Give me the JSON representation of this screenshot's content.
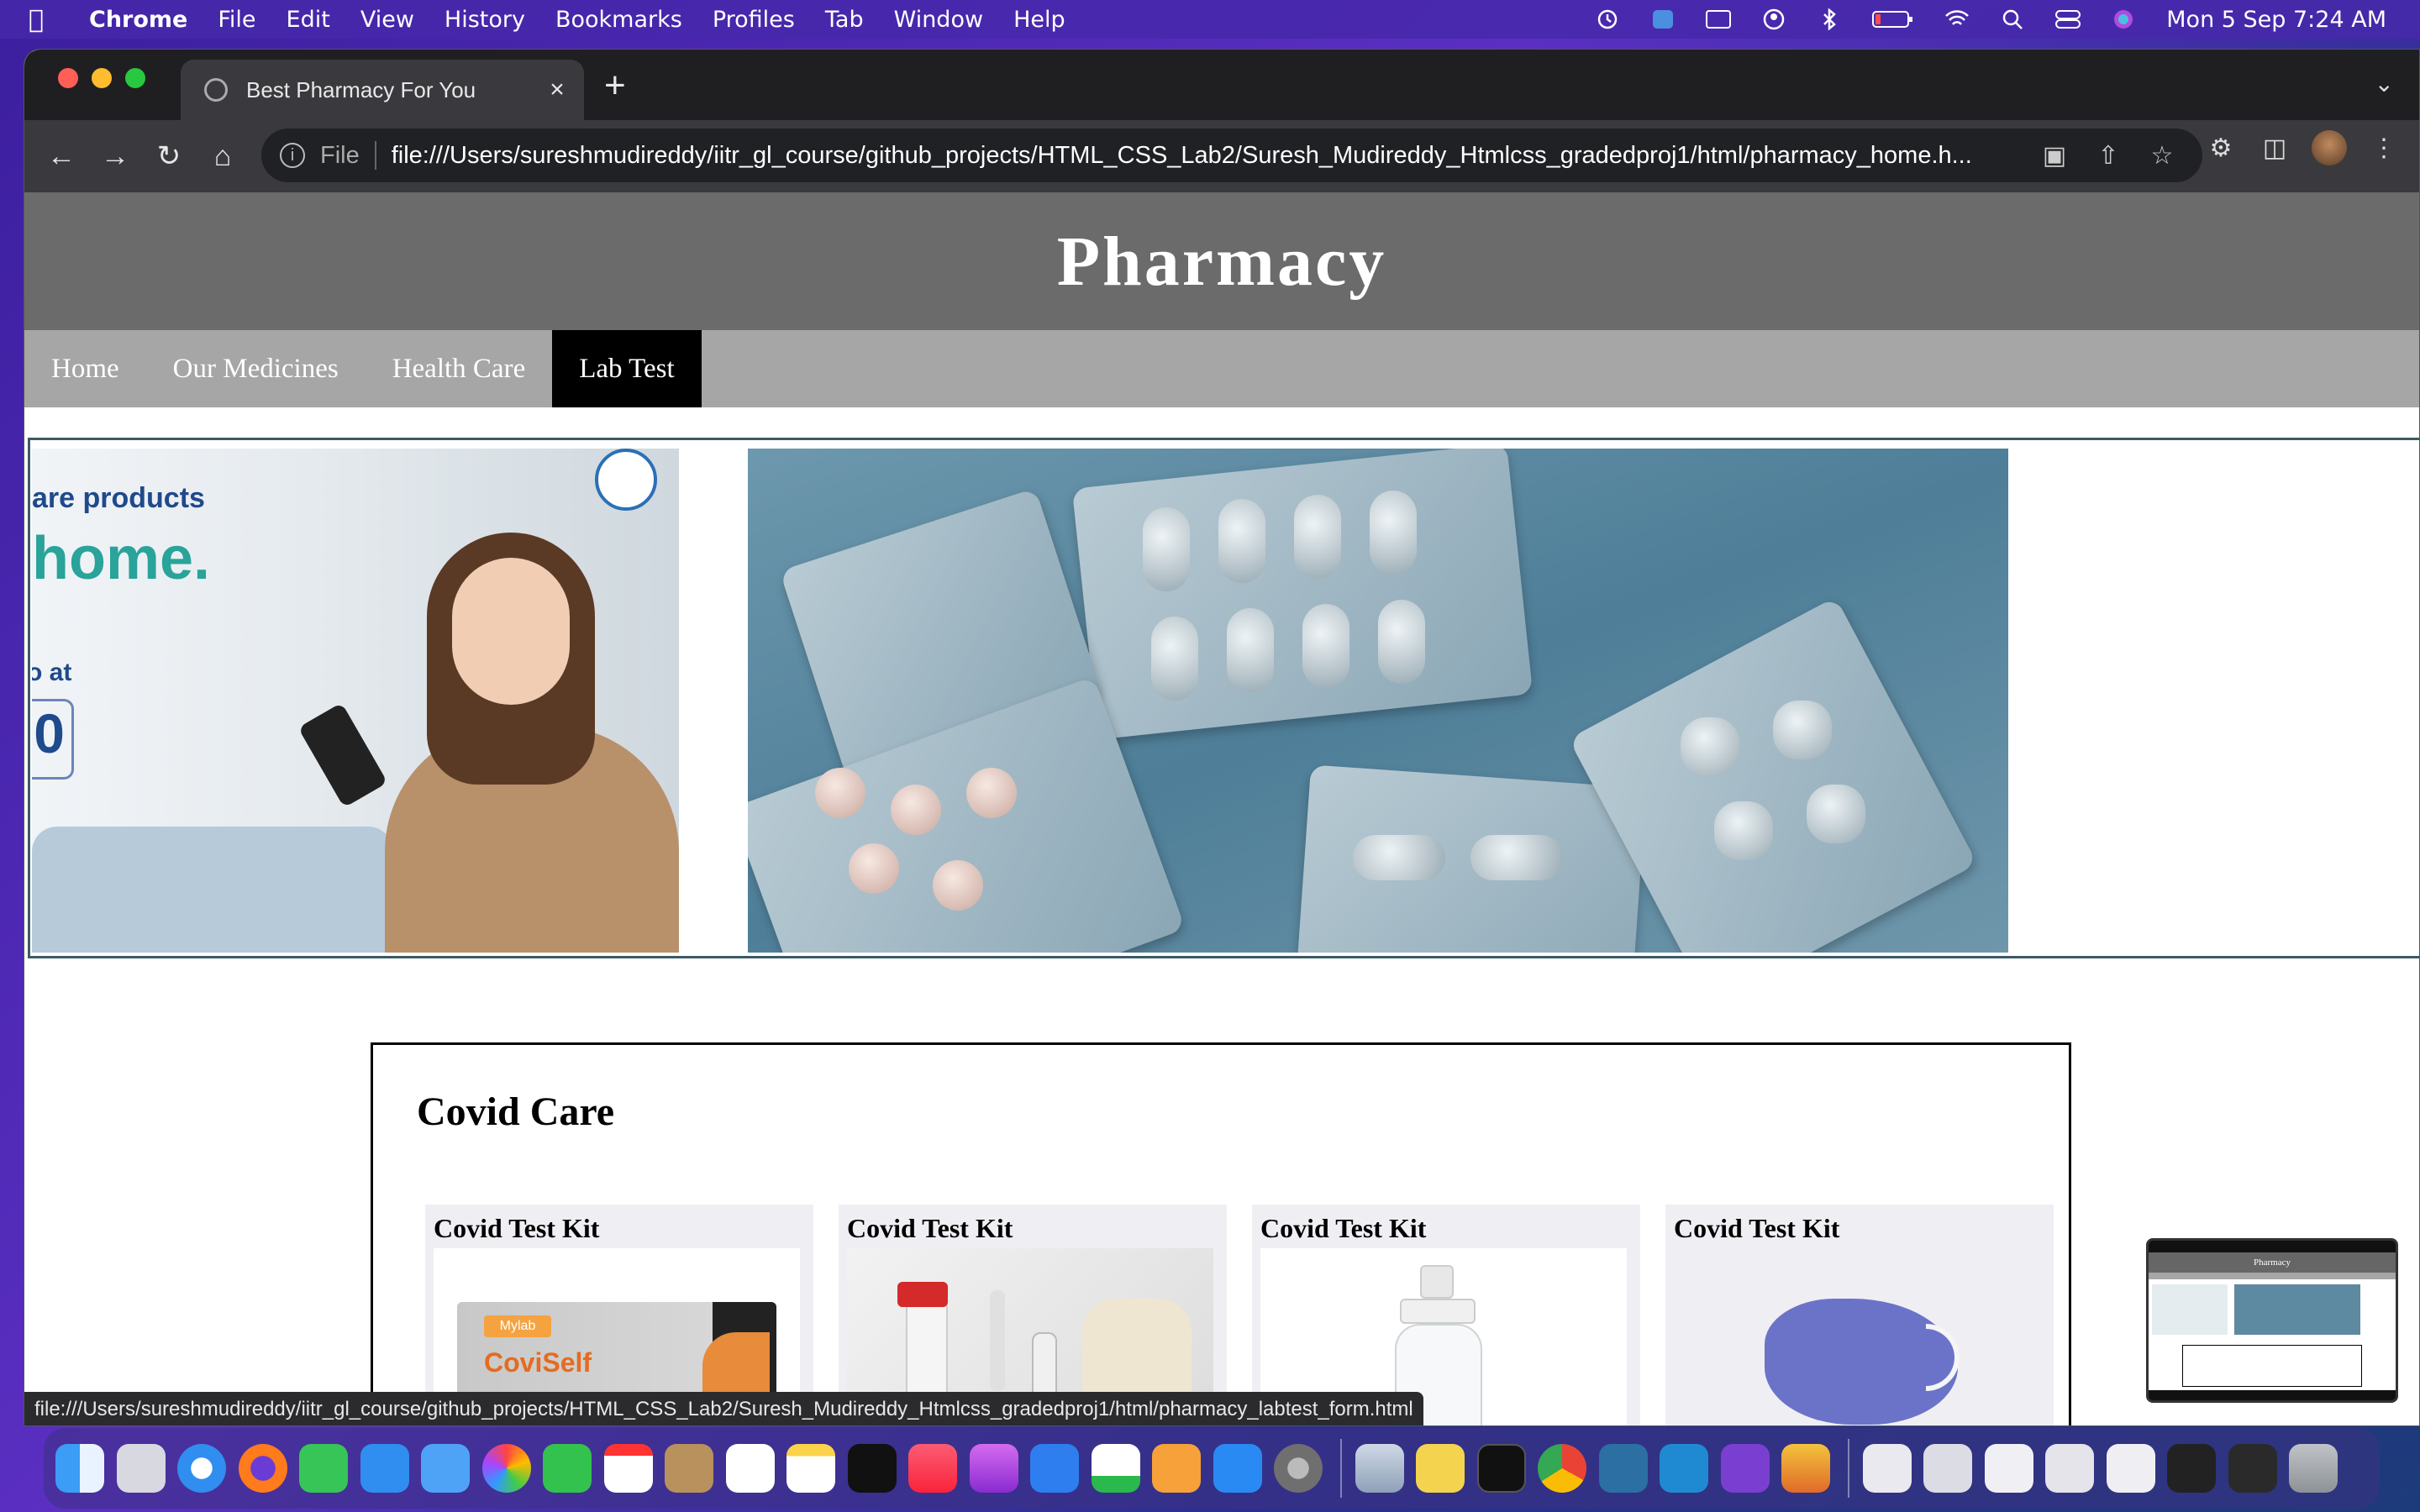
{
  "menubar": {
    "app": "Chrome",
    "items": [
      "File",
      "Edit",
      "View",
      "History",
      "Bookmarks",
      "Profiles",
      "Tab",
      "Window",
      "Help"
    ],
    "clock": "Mon 5 Sep  7:24 AM"
  },
  "browser": {
    "tab_title": "Best Pharmacy For You",
    "address_scheme": "File",
    "address_url": "file:///Users/sureshmudireddy/iitr_gl_course/github_projects/HTML_CSS_Lab2/Suresh_Mudireddy_Htmlcss_gradedproj1/html/pharmacy_home.h...",
    "status_link": "file:///Users/sureshmudireddy/iitr_gl_course/github_projects/HTML_CSS_Lab2/Suresh_Mudireddy_Htmlcss_gradedproj1/html/pharmacy_labtest_form.html"
  },
  "site": {
    "title": "Pharmacy",
    "nav": [
      "Home",
      "Our Medicines",
      "Health Care",
      "Lab Test"
    ],
    "active_nav": "Lab Test",
    "banner": {
      "line1": "are products",
      "line2": "home.",
      "line3": "o at",
      "line4": "0"
    },
    "covid_section": {
      "heading": "Covid Care",
      "cards": [
        {
          "title": "Covid Test Kit",
          "product_text": "CoviSelf",
          "brand": "Mylab"
        },
        {
          "title": "Covid Test Kit"
        },
        {
          "title": "Covid Test Kit"
        },
        {
          "title": "Covid Test Kit"
        }
      ]
    }
  },
  "pip": {
    "title": "Pharmacy"
  },
  "colors": {
    "header_bg": "#6b6b6b",
    "nav_bg": "#a6a6a6",
    "nav_active": "#000000",
    "card_bg": "#efeff3"
  }
}
